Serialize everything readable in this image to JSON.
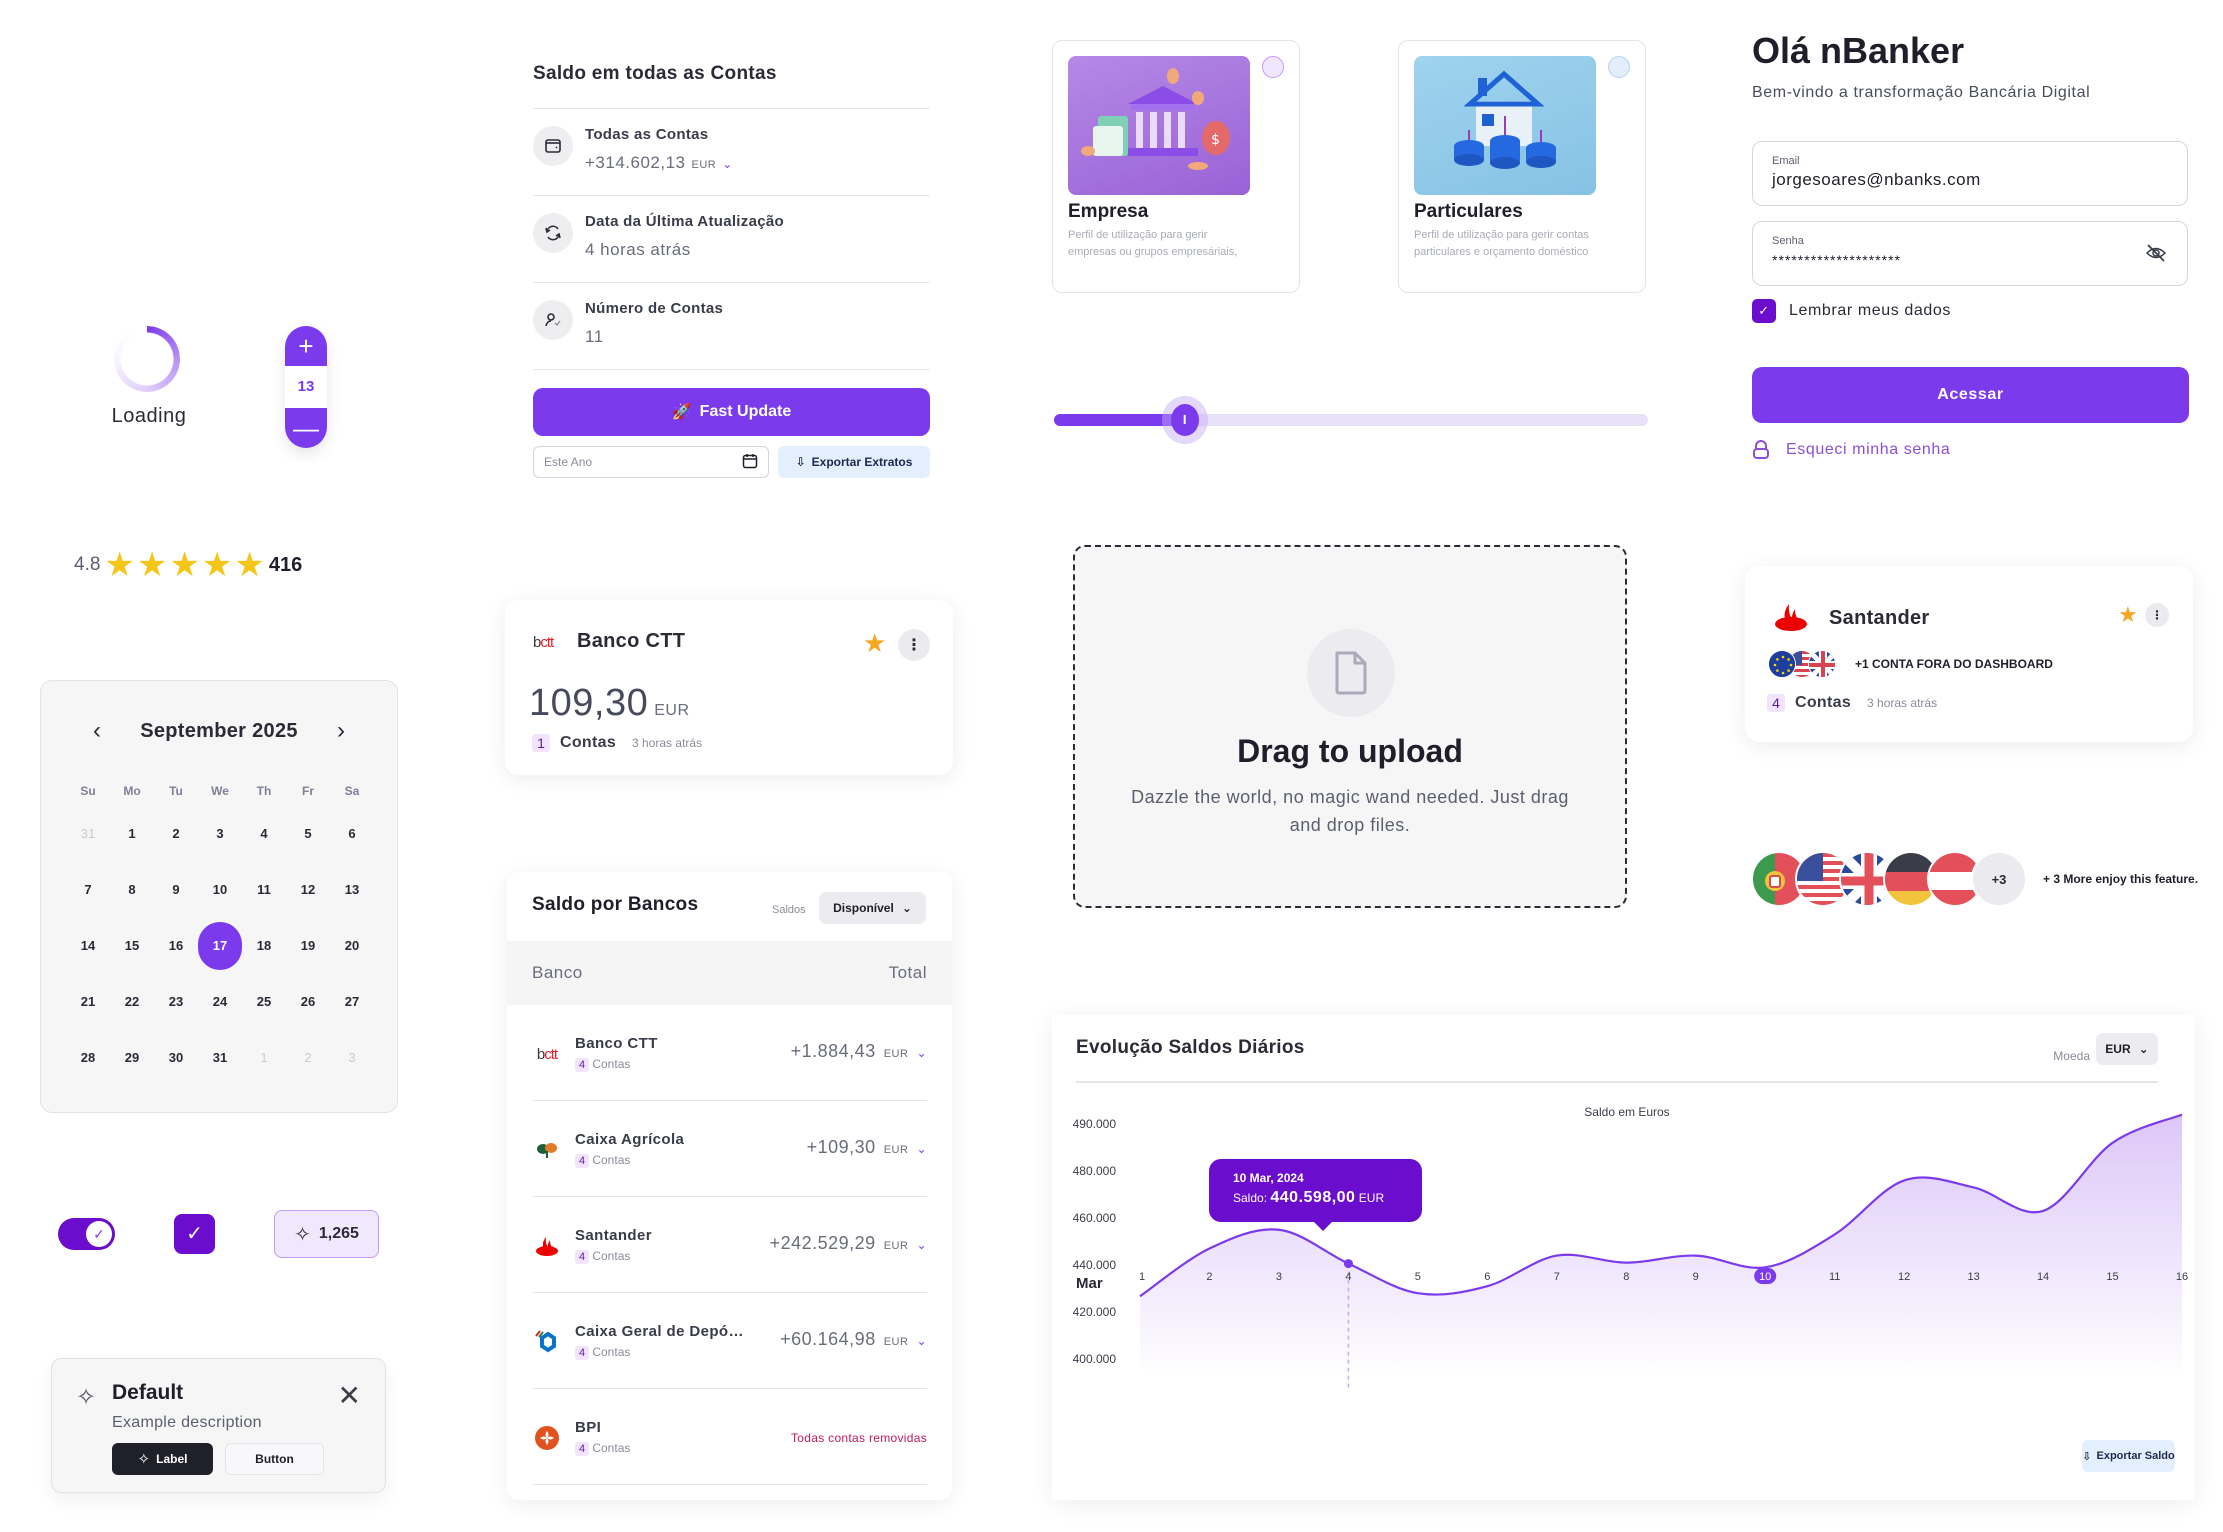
{
  "loading": {
    "label": "Loading"
  },
  "stepper": {
    "plus": "+",
    "value": "13",
    "minus": "—"
  },
  "rating": {
    "score": "4.8",
    "stars": 5,
    "star_glyph": "★",
    "count": "416"
  },
  "calendar": {
    "title": "September 2025",
    "prev_icon": "‹",
    "next_icon": "›",
    "weekdays": [
      "Su",
      "Mo",
      "Tu",
      "We",
      "Th",
      "Fr",
      "Sa"
    ],
    "days": [
      {
        "d": "31",
        "other": true
      },
      {
        "d": "1"
      },
      {
        "d": "2"
      },
      {
        "d": "3"
      },
      {
        "d": "4"
      },
      {
        "d": "5"
      },
      {
        "d": "6"
      },
      {
        "d": "7"
      },
      {
        "d": "8"
      },
      {
        "d": "9"
      },
      {
        "d": "10"
      },
      {
        "d": "11"
      },
      {
        "d": "12"
      },
      {
        "d": "13"
      },
      {
        "d": "14"
      },
      {
        "d": "15"
      },
      {
        "d": "16"
      },
      {
        "d": "17",
        "selected": true
      },
      {
        "d": "18"
      },
      {
        "d": "19"
      },
      {
        "d": "20"
      },
      {
        "d": "21"
      },
      {
        "d": "22"
      },
      {
        "d": "23"
      },
      {
        "d": "24"
      },
      {
        "d": "25"
      },
      {
        "d": "26"
      },
      {
        "d": "27"
      },
      {
        "d": "28"
      },
      {
        "d": "29"
      },
      {
        "d": "30"
      },
      {
        "d": "31"
      },
      {
        "d": "1",
        "other": true
      },
      {
        "d": "2",
        "other": true
      },
      {
        "d": "3",
        "other": true
      }
    ]
  },
  "controls": {
    "toggle_on": true,
    "checkbox_checked": true,
    "check_glyph": "✓",
    "badge_count": "1,265",
    "sparkle_glyph": "✧"
  },
  "alert": {
    "title": "Default",
    "description": "Example description",
    "primary_label": "Label",
    "secondary_label": "Button",
    "close_glyph": "✕"
  },
  "summary": {
    "title": "Saldo em todas as Contas",
    "rows": [
      {
        "icon": "wallet-icon",
        "label": "Todas as Contas",
        "value": "+314.602,13",
        "currency": "EUR",
        "chevron": "⌄"
      },
      {
        "icon": "refresh-icon",
        "label": "Data da Última Atualização",
        "value": "4 horas atrás"
      },
      {
        "icon": "user-check-icon",
        "label": "Número de Contas",
        "value": "11"
      }
    ],
    "fast_update_label": "Fast Update",
    "year_placeholder": "Este Ano",
    "export_label": "Exportar Extratos"
  },
  "bank_card": {
    "name": "Banco CTT",
    "logo_b": "b",
    "logo_ctt": "ctt",
    "amount": "109,30",
    "currency": "EUR",
    "accounts": "1",
    "accounts_label": "Contas",
    "updated": "3 horas atrás",
    "favorite": true
  },
  "banks_table": {
    "title": "Saldo por Bancos",
    "filter_label": "Saldos",
    "filter_value": "Disponível",
    "columns": [
      "Banco",
      "Total"
    ],
    "rows": [
      {
        "name": "Banco CTT",
        "logo": "bctt",
        "accounts": "4",
        "accounts_label": "Contas",
        "total": "+1.884,43",
        "currency": "EUR"
      },
      {
        "name": "Caixa Agrícola",
        "logo": "ca",
        "accounts": "4",
        "accounts_label": "Contas",
        "total": "+109,30",
        "currency": "EUR"
      },
      {
        "name": "Santander",
        "logo": "santander",
        "accounts": "4",
        "accounts_label": "Contas",
        "total": "+242.529,29",
        "currency": "EUR"
      },
      {
        "name": "Caixa Geral de Depósitos",
        "logo": "cgd",
        "accounts": "4",
        "accounts_label": "Contas",
        "total": "+60.164,98",
        "currency": "EUR"
      },
      {
        "name": "BPI",
        "logo": "bpi",
        "accounts": "4",
        "accounts_label": "Contas",
        "status": "Todas contas removidas"
      }
    ]
  },
  "profiles": [
    {
      "title": "Empresa",
      "description": "Perfil de utilização para gerir empresas ou grupos empresáriais,",
      "color": "#a974e0",
      "radio_color": "#f1e6ff"
    },
    {
      "title": "Particulares",
      "description": "Perfil de utilização para gerir contas particulares e orçamento doméstico",
      "color": "#92c9e8",
      "radio_color": "#e3eefc"
    }
  ],
  "slider": {
    "value_fraction": 0.22,
    "thumb_label": "I"
  },
  "upload": {
    "title": "Drag to upload",
    "description": "Dazzle the world, no magic wand needed. Just drag and drop files."
  },
  "login": {
    "title": "Olá nBanker",
    "subtitle": "Bem-vindo a transformação Bancária Digital",
    "email_label": "Email",
    "email_value": "jorgesoares@nbanks.com",
    "password_label": "Senha",
    "password_value": "********************",
    "remember_label": "Lembrar meus dados",
    "remember_checked": true,
    "submit_label": "Acessar",
    "forgot_label": "Esqueci minha senha"
  },
  "santander_card": {
    "name": "Santander",
    "outside_label": "+1 CONTA FORA DO DASHBOARD",
    "accounts": "4",
    "accounts_label": "Contas",
    "updated": "3 horas atrás",
    "favorite": true,
    "flags": [
      "EU",
      "US",
      "UK"
    ]
  },
  "avatars": {
    "flags": [
      "PT",
      "US",
      "UK",
      "DE",
      "AT"
    ],
    "more": "+3",
    "note": "+ 3 More enjoy this feature."
  },
  "chart_card": {
    "title": "Evolução Saldos Diários",
    "currency_label": "Moeda",
    "currency_value": "EUR",
    "export_label": "Exportar Saldo",
    "tooltip": {
      "date": "10 Mar, 2024",
      "label": "Saldo:",
      "value": "440.598,00",
      "currency": "EUR"
    }
  },
  "chart_data": {
    "type": "area",
    "title": "Saldo em Euros",
    "xlabel": "Mar",
    "ylabel": "",
    "x": [
      1,
      2,
      3,
      4,
      5,
      6,
      7,
      8,
      9,
      10,
      11,
      12,
      13,
      14,
      15,
      16
    ],
    "x_tick_labels": [
      "1",
      "2",
      "3",
      "4",
      "5",
      "6",
      "7",
      "8",
      "9",
      "10",
      "11",
      "12",
      "13",
      "14",
      "15",
      "16"
    ],
    "highlighted_x": 10,
    "y_tick_labels": [
      "400.000",
      "420.000",
      "440.000",
      "460.000",
      "480.000",
      "490.000"
    ],
    "y_tick_values": [
      400000,
      420000,
      440000,
      460000,
      480000,
      490000
    ],
    "series": [
      {
        "name": "Saldo",
        "values": [
          426700,
          447000,
          455000,
          440598,
          428000,
          431000,
          444000,
          441000,
          444000,
          439000,
          453000,
          476000,
          473000,
          463000,
          486000,
          492000
        ]
      }
    ],
    "tooltip_x": 4,
    "grid": false,
    "legend": "none"
  }
}
